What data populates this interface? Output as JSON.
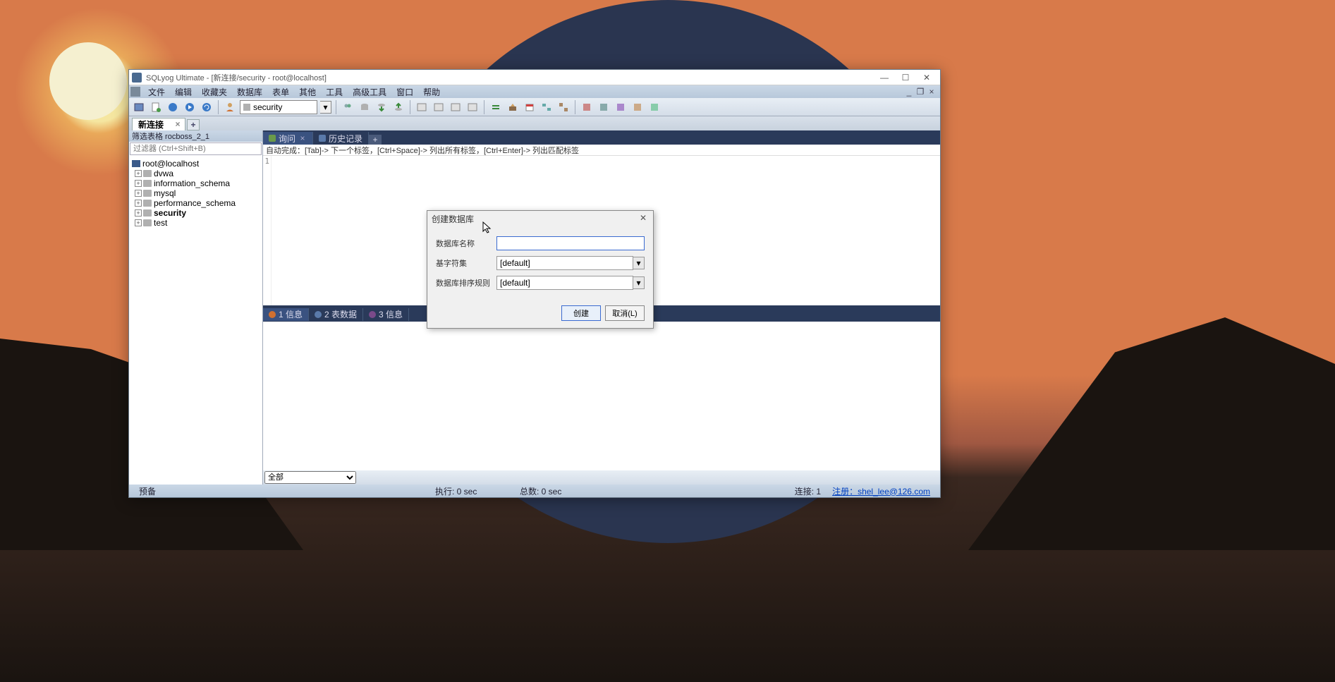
{
  "titlebar": {
    "text": "SQLyog Ultimate - [新连接/security - root@localhost]"
  },
  "menubar": {
    "items": [
      "文件",
      "编辑",
      "收藏夹",
      "数据库",
      "表单",
      "其他",
      "工具",
      "高级工具",
      "窗口",
      "帮助"
    ]
  },
  "toolbar": {
    "db_selected": "security"
  },
  "conn_tab": {
    "label": "新连接"
  },
  "sidebar": {
    "filter_label": "筛选表格 rocboss_2_1",
    "filter_placeholder": "过滤器 (Ctrl+Shift+B)",
    "host": "root@localhost",
    "dbs": [
      "dvwa",
      "information_schema",
      "mysql",
      "performance_schema",
      "security",
      "test"
    ],
    "bold_index": 4
  },
  "query_tabs": {
    "query": "询问",
    "history": "历史记录"
  },
  "hint": "自动完成：[Tab]-> 下一个标签，[Ctrl+Space]-> 列出所有标签，[Ctrl+Enter]-> 列出匹配标签",
  "result_tabs": {
    "t1": "1 信息",
    "t2": "2 表数据",
    "t3": "3 信息"
  },
  "bottom_select": "全部",
  "statusbar": {
    "ready": "预备",
    "exec": "执行: 0 sec",
    "total": "总数: 0 sec",
    "conn": "连接: 1",
    "register": "注册：shel_lee@126.com"
  },
  "dialog": {
    "title": "创建数据库",
    "name_label": "数据库名称",
    "name_value": "",
    "charset_label": "基字符集",
    "charset_value": "[default]",
    "collation_label": "数据库排序规则",
    "collation_value": "[default]",
    "create": "创建",
    "cancel": "取消(L)"
  }
}
